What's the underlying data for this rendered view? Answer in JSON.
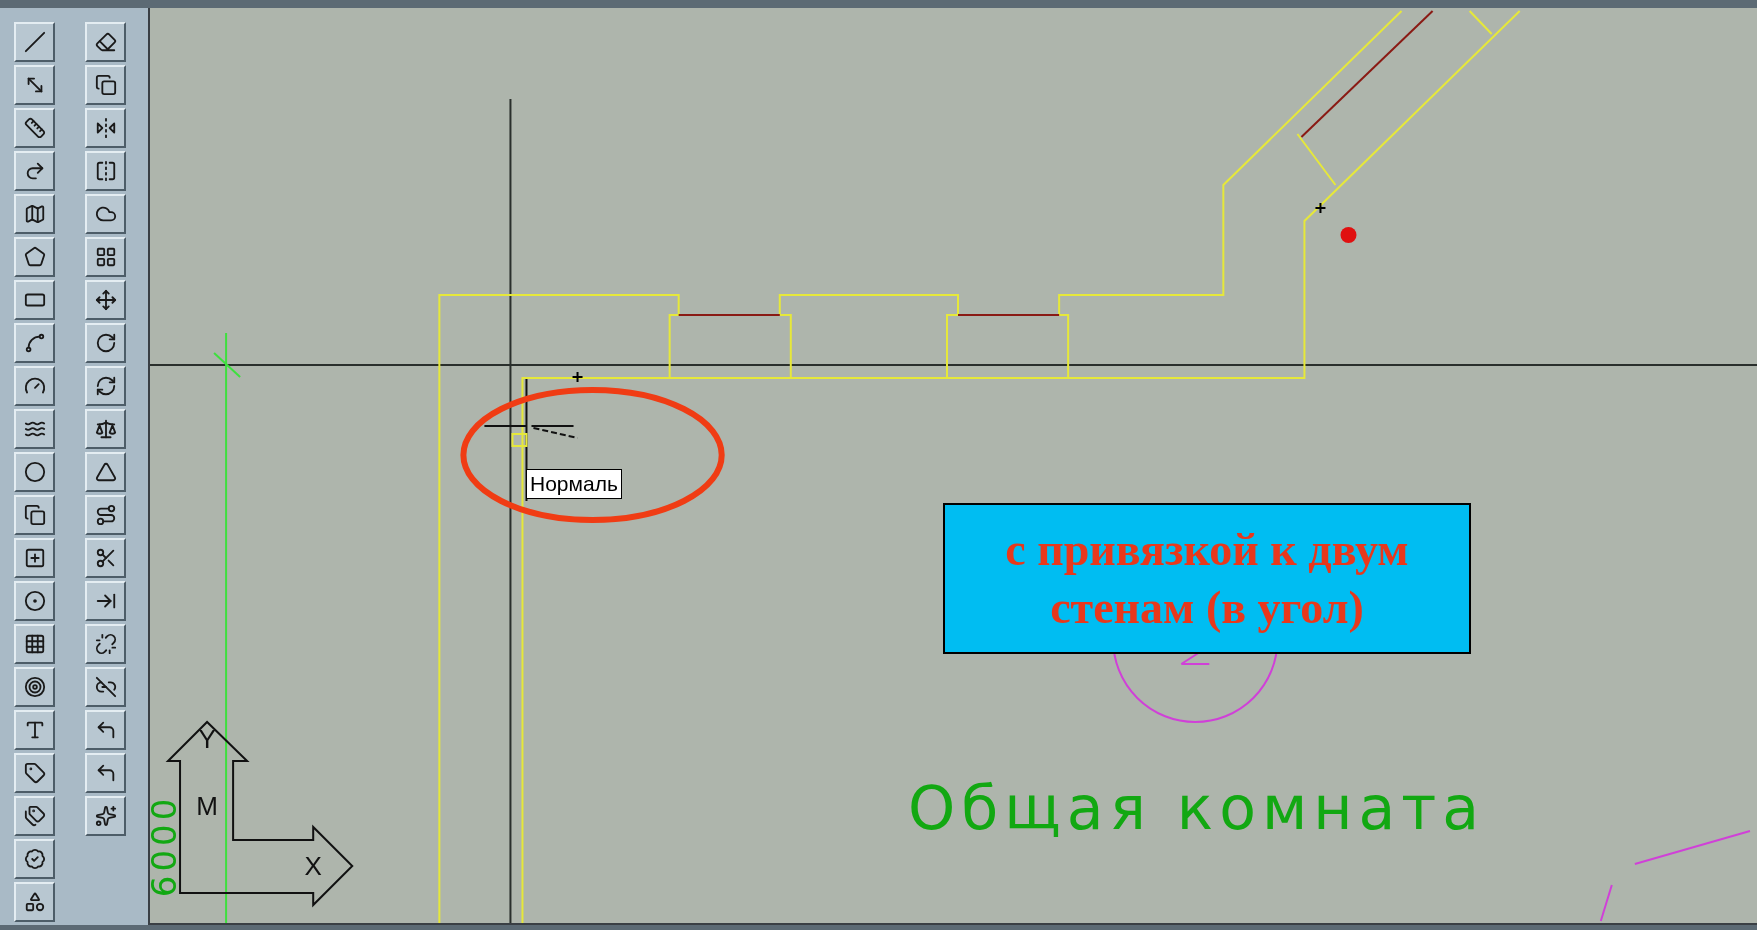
{
  "tooltip": {
    "text": "Нормаль"
  },
  "callout": {
    "text": "с привязкой к двум стенам (в угол)"
  },
  "room_label": {
    "text": "Общая комната"
  },
  "dimension_text": {
    "text": "6000"
  },
  "ucs_icon": {
    "y_axis": "Y",
    "marker": "M",
    "x_axis": "X"
  }
}
